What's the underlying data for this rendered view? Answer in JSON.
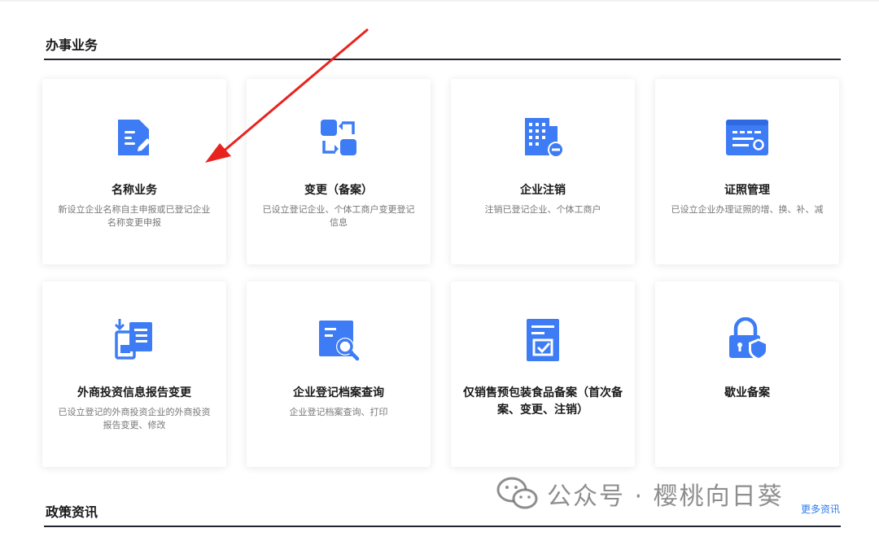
{
  "sections": {
    "services_title": "办事业务",
    "policy_title": "政策资讯",
    "more_label": "更多资讯"
  },
  "cards": [
    {
      "title": "名称业务",
      "desc": "新设立企业名称自主申报或已登记企业名称变更申报",
      "icon": "document-edit-icon"
    },
    {
      "title": "变更（备案）",
      "desc": "已设立登记企业、个体工商户变更登记信息",
      "icon": "swap-icon"
    },
    {
      "title": "企业注销",
      "desc": "注销已登记企业、个体工商户",
      "icon": "building-minus-icon"
    },
    {
      "title": "证照管理",
      "desc": "已设立企业办理证照的增、换、补、减",
      "icon": "license-icon"
    },
    {
      "title": "外商投资信息报告变更",
      "desc": "已设立登记的外商投资企业的外商投资报告变更、修改",
      "icon": "report-transfer-icon"
    },
    {
      "title": "企业登记档案查询",
      "desc": "企业登记档案查询、打印",
      "icon": "document-search-icon"
    },
    {
      "title": "仅销售预包装食品备案（首次备案、变更、注销）",
      "desc": "",
      "icon": "document-check-icon"
    },
    {
      "title": "歇业备案",
      "desc": "",
      "icon": "lock-shield-icon"
    }
  ],
  "watermark": "公众号 · 樱桃向日葵",
  "colors": {
    "accent": "#3d7cf5",
    "annotation_arrow": "#e8231f",
    "divider": "#1f2430"
  }
}
